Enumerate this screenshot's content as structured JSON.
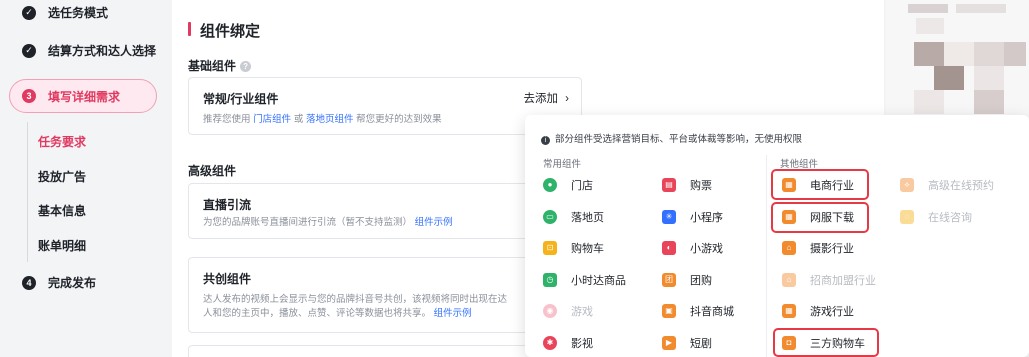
{
  "steps": [
    {
      "num": "✓",
      "label": "选任务模式",
      "state": "done"
    },
    {
      "num": "✓",
      "label": "结算方式和达人选择",
      "state": "done"
    },
    {
      "num": "3",
      "label": "填写详细需求",
      "state": "active"
    },
    {
      "num": "4",
      "label": "完成发布",
      "state": "todo"
    }
  ],
  "substeps": [
    {
      "label": "任务要求",
      "active": true
    },
    {
      "label": "投放广告",
      "active": false
    },
    {
      "label": "基本信息",
      "active": false
    },
    {
      "label": "账单明细",
      "active": false
    }
  ],
  "main": {
    "title": "组件绑定",
    "basic_label": "基础组件",
    "advanced_label": "高级组件",
    "card_normal": {
      "title": "常规/行业组件",
      "desc_prefix": "推荐您使用",
      "link1": "门店组件",
      "or": "或",
      "link2": "落地页组件",
      "desc_suffix": "帮您更好的达到效果",
      "action": "去添加"
    },
    "card_live": {
      "title": "直播引流",
      "desc": "为您的品牌账号直播间进行引流（暂不支持监测）",
      "link": "组件示例"
    },
    "card_cocreate": {
      "title": "共创组件",
      "desc_line1": "达人发布的视频上会显示与您的品牌抖音号共创，该视频将同时出现在达",
      "desc_line2": "人和您的主页中，播放、点赞、评论等数据也将共享。",
      "link": "组件示例"
    }
  },
  "popup": {
    "notice": "部分组件受选择营销目标、平台或体裁等影响，无使用权限",
    "common_title": "常用组件",
    "other_title": "其他组件",
    "common_col1": [
      {
        "label": "门店",
        "icon": "location-icon",
        "color": "#2fb36b",
        "disabled": false
      },
      {
        "label": "落地页",
        "icon": "landing-page-icon",
        "color": "#2fb36b",
        "disabled": false
      },
      {
        "label": "购物车",
        "icon": "cart-icon",
        "color": "#f5b21b",
        "disabled": false
      },
      {
        "label": "小时达商品",
        "icon": "clock-icon",
        "color": "#2fb36b",
        "disabled": false
      },
      {
        "label": "游戏",
        "icon": "gamepad-icon",
        "color": "#f07a8d",
        "disabled": true
      },
      {
        "label": "影视",
        "icon": "film-icon",
        "color": "#e9455a",
        "disabled": false
      }
    ],
    "common_col2": [
      {
        "label": "购票",
        "icon": "ticket-icon",
        "color": "#e9455a",
        "disabled": false
      },
      {
        "label": "小程序",
        "icon": "miniapp-icon",
        "color": "#3370ff",
        "disabled": false
      },
      {
        "label": "小游戏",
        "icon": "minigame-icon",
        "color": "#e9455a",
        "disabled": false
      },
      {
        "label": "团购",
        "icon": "groupbuy-icon",
        "color": "#f28a2e",
        "disabled": false
      },
      {
        "label": "抖音商城",
        "icon": "mall-icon",
        "color": "#f28a2e",
        "disabled": false
      },
      {
        "label": "短剧",
        "icon": "play-icon",
        "color": "#f28a2e",
        "disabled": false
      }
    ],
    "other_col1": [
      {
        "label": "电商行业",
        "icon": "grid-icon",
        "color": "#f28a2e",
        "disabled": false,
        "highlight": true
      },
      {
        "label": "网服下载",
        "icon": "grid-icon",
        "color": "#f28a2e",
        "disabled": false,
        "highlight": true
      },
      {
        "label": "摄影行业",
        "icon": "house-icon",
        "color": "#f28a2e",
        "disabled": false,
        "highlight": false
      },
      {
        "label": "招商加盟行业",
        "icon": "house-icon",
        "color": "#f28a2e",
        "disabled": true,
        "highlight": false
      },
      {
        "label": "游戏行业",
        "icon": "grid-icon",
        "color": "#f28a2e",
        "disabled": false,
        "highlight": false
      },
      {
        "label": "三方购物车",
        "icon": "bag-icon",
        "color": "#f28a2e",
        "disabled": false,
        "highlight": true
      }
    ],
    "other_col2": [
      {
        "label": "高级在线预约",
        "icon": "booking-icon",
        "color": "#f28a2e",
        "disabled": true
      },
      {
        "label": "在线咨询",
        "icon": "chat-icon",
        "color": "#f5b21b",
        "disabled": true
      }
    ]
  }
}
